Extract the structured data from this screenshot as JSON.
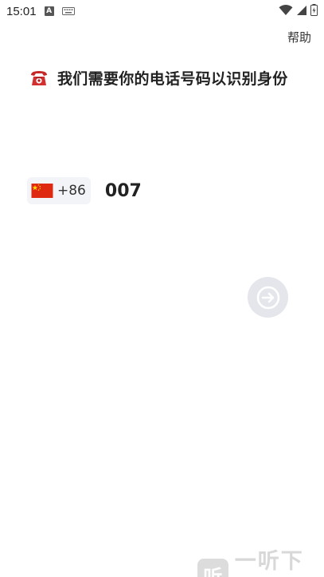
{
  "status_bar": {
    "time": "15:01",
    "input_badge": "A"
  },
  "header": {
    "help_label": "帮助"
  },
  "title": {
    "text": "我们需要你的电话号码以识别身份"
  },
  "phone_input": {
    "country_code": "+86",
    "number": "007"
  },
  "watermark": {
    "logo_char": "听",
    "text": "一听下载"
  },
  "colors": {
    "next_button_bg": "#e4e6eb",
    "country_chip_bg": "#f3f4f7",
    "flag_red": "#de2910",
    "flag_yellow": "#ffde00"
  }
}
